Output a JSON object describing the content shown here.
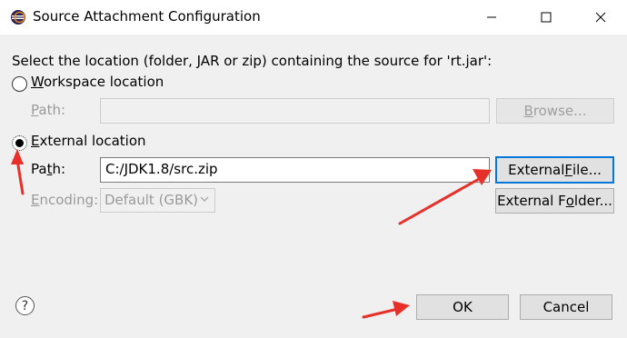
{
  "window": {
    "title": "Source Attachment Configuration"
  },
  "dialog": {
    "prompt": "Select the location (folder, JAR or zip) containing the source for 'rt.jar':",
    "workspace": {
      "radio_label_first": "W",
      "radio_label_rest": "orkspace location",
      "selected": false,
      "path_label_first": "P",
      "path_label_rest": "ath:",
      "path_value": "",
      "browse_label_first": "B",
      "browse_label_rest": "rowse..."
    },
    "external": {
      "radio_label_first": "E",
      "radio_label_rest": "xternal location",
      "selected": true,
      "path_label_first": "Pa",
      "path_label_mid": "t",
      "path_label_rest": "h:",
      "path_value": "C:/JDK1.8/src.zip",
      "encoding_label_first": "E",
      "encoding_label_rest": "ncoding:",
      "encoding_value": "Default (GBK)",
      "file_button_pre": "External ",
      "file_button_ul": "F",
      "file_button_post": "ile...",
      "folder_button_pre": "External F",
      "folder_button_ul": "o",
      "folder_button_post": "lder..."
    },
    "ok_label": "OK",
    "cancel_label": "Cancel"
  },
  "colors": {
    "accent_blue": "#0078d7",
    "annotation_red": "#e8302a",
    "disabled_text": "#9a9a9a",
    "dialog_bg": "#f0f0f0"
  },
  "icons": [
    "eclipse-icon",
    "minimize-icon",
    "maximize-icon",
    "close-icon",
    "help-icon",
    "chevron-down-icon"
  ]
}
